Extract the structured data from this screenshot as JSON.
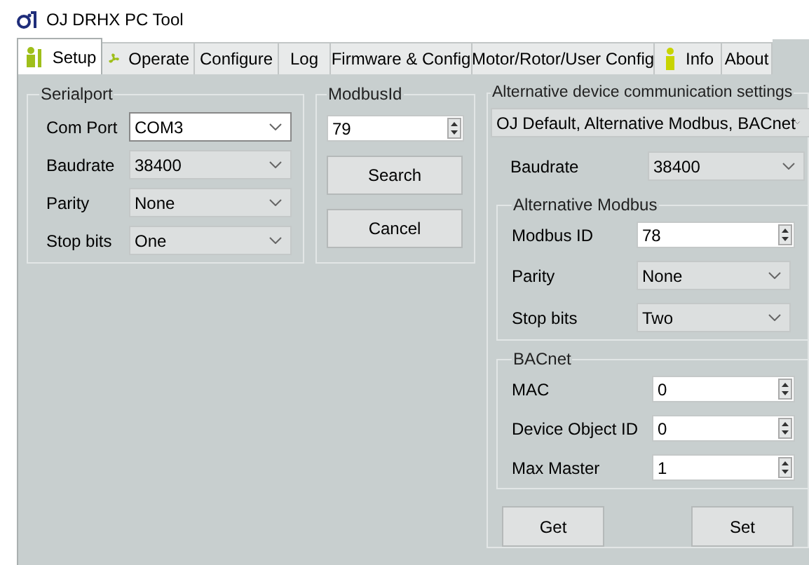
{
  "window": {
    "title": "OJ DRHX PC Tool"
  },
  "tabs": [
    {
      "label": "Setup",
      "selected": true,
      "kind": "worker"
    },
    {
      "label": "Operate",
      "selected": false,
      "kind": "fan"
    },
    {
      "label": "Configure",
      "selected": false,
      "kind": "plain"
    },
    {
      "label": "Log",
      "selected": false,
      "kind": "plain"
    },
    {
      "label": "Firmware & Config",
      "selected": false,
      "kind": "plain"
    },
    {
      "label": "Motor/Rotor/User Config",
      "selected": false,
      "kind": "plain"
    },
    {
      "label": "Info",
      "selected": false,
      "kind": "info"
    },
    {
      "label": "About",
      "selected": false,
      "kind": "plain"
    }
  ],
  "serialport": {
    "title": "Serialport",
    "fields": [
      {
        "label": "Com Port",
        "value": "COM3",
        "disabled": false
      },
      {
        "label": "Baudrate",
        "value": "38400",
        "disabled": true
      },
      {
        "label": "Parity",
        "value": "None",
        "disabled": true
      },
      {
        "label": "Stop bits",
        "value": "One",
        "disabled": true
      }
    ]
  },
  "modbus_id": {
    "title": "ModbusId",
    "value": "79",
    "buttons": [
      "Search",
      "Cancel"
    ]
  },
  "alternative_settings": {
    "title": "Alternative device communication settings",
    "mode": {
      "value": "OJ Default, Alternative Modbus, BACnet",
      "disabled": true
    },
    "baudrate": {
      "label": "Baudrate",
      "value": "38400",
      "disabled": true
    },
    "alternative_modbus": {
      "title": "Alternative Modbus",
      "fields": [
        {
          "kind": "spin",
          "label": "Modbus ID",
          "value": "78"
        },
        {
          "kind": "combo",
          "label": "Parity",
          "value": "None",
          "disabled": true
        },
        {
          "kind": "combo",
          "label": "Stop bits",
          "value": "Two",
          "disabled": true
        }
      ]
    },
    "bacnet": {
      "title": "BACnet",
      "fields": [
        {
          "kind": "spin",
          "label": "MAC",
          "value": "0"
        },
        {
          "kind": "spin",
          "label": "Device Object ID",
          "value": "0"
        },
        {
          "kind": "spin",
          "label": "Max Master",
          "value": "1"
        }
      ]
    },
    "buttons": [
      "Get",
      "Set"
    ]
  }
}
